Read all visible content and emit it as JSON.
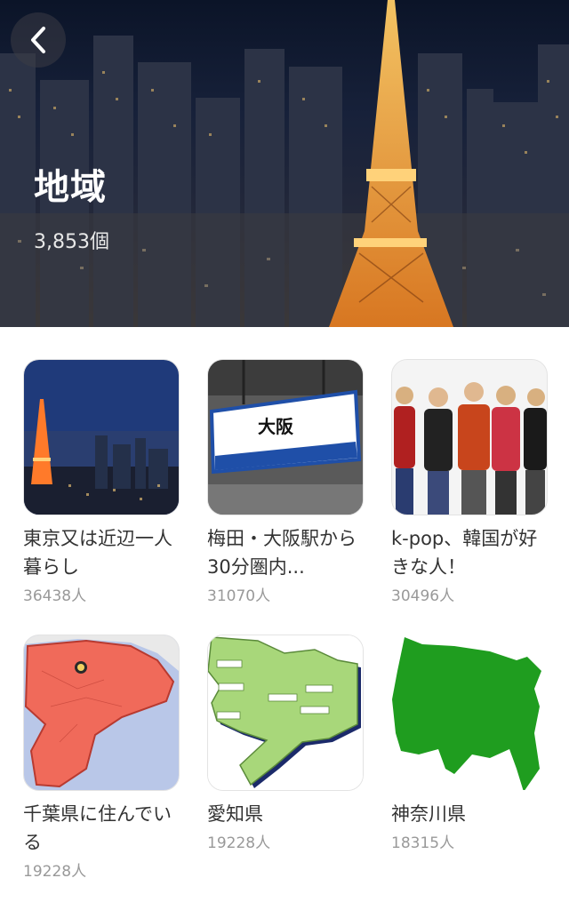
{
  "header": {
    "title": "地域",
    "count": "3,853個",
    "back_icon": "chevron-left-icon"
  },
  "groups": [
    {
      "title": "東京又は近辺一人暮らし",
      "members": "36438人",
      "image": "tokyo-tower-night"
    },
    {
      "title": "梅田・大阪駅から30分圏内...",
      "members": "31070人",
      "image": "osaka-station-sign"
    },
    {
      "title": "k-pop、韓国が好きな人！",
      "members": "30496人",
      "image": "kpop-group-photo"
    },
    {
      "title": "千葉県に住んでいる",
      "members": "19228人",
      "image": "chiba-map"
    },
    {
      "title": "愛知県",
      "members": "19228人",
      "image": "aichi-map"
    },
    {
      "title": "神奈川県",
      "members": "18315人",
      "image": "kanagawa-map"
    }
  ],
  "colors": {
    "title_text": "#333333",
    "count_text": "#999999",
    "chiba_red": "#f06a5a",
    "aichi_green": "#a8d77a",
    "kanagawa_green": "#1f9d1f"
  }
}
